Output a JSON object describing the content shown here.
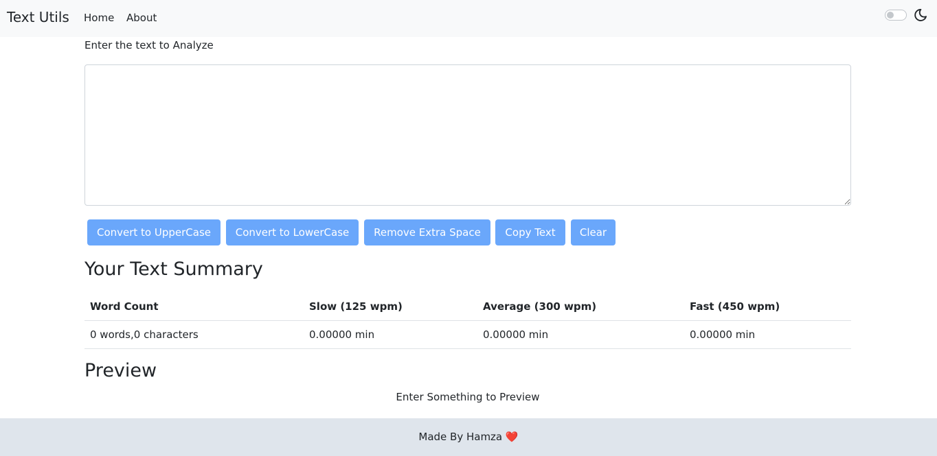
{
  "navbar": {
    "brand": "Text Utils",
    "links": [
      "Home",
      "About"
    ],
    "dark_mode_toggle": "off"
  },
  "form": {
    "label": "Enter the text to Analyze",
    "textarea_value": ""
  },
  "buttons": {
    "uppercase": "Convert to UpperCase",
    "lowercase": "Convert to LowerCase",
    "remove_space": "Remove Extra Space",
    "copy": "Copy Text",
    "clear": "Clear"
  },
  "summary": {
    "heading": "Your Text Summary",
    "columns": [
      "Word Count",
      "Slow (125 wpm)",
      "Average (300 wpm)",
      "Fast (450 wpm)"
    ],
    "row": [
      "0 words,0 characters",
      "0.00000 min",
      "0.00000 min",
      "0.00000 min"
    ]
  },
  "preview": {
    "heading": "Preview",
    "text": "Enter Something to Preview"
  },
  "footer": {
    "text": "Made By Hamza",
    "heart": "❤️"
  },
  "colors": {
    "button_bg": "#6aa7fb",
    "navbar_bg": "#f8f9fa",
    "footer_bg": "#dfe5ec"
  },
  "icons": {
    "theme": "moon-icon"
  }
}
